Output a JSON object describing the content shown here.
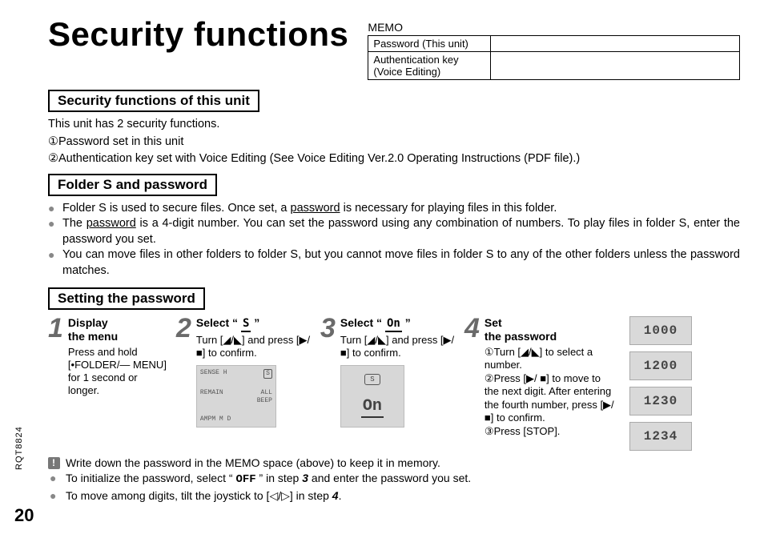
{
  "title": "Security functions",
  "memo": {
    "label": "MEMO",
    "row1": "Password (This unit)",
    "row2": "Authentication key\n(Voice Editing)"
  },
  "sections": {
    "sec1_head": "Security functions of this unit",
    "sec1_intro": "This unit has 2 security functions.",
    "sec1_item1": "①Password set in this unit",
    "sec1_item2": "②Authentication key set with Voice Editing (See Voice Editing Ver.2.0 Operating Instructions (PDF file).)",
    "sec2_head": "Folder S and password",
    "sec2_b1a": "Folder S is used to secure files. Once set, a ",
    "sec2_b1b": "password",
    "sec2_b1c": " is necessary for playing files in this folder.",
    "sec2_b2a": "The ",
    "sec2_b2b": "password",
    "sec2_b2c": " is a 4-digit number. You can set the password using any combination of numbers. To play files in folder S, enter the password you set.",
    "sec2_b3": "You can move files in other folders to folder S, but you cannot move files in folder S to any of the other folders unless the password matches.",
    "sec3_head": "Setting the password"
  },
  "steps": {
    "s1_title": "Display\nthe menu",
    "s1_body": "Press and hold [•FOLDER/— MENU] for 1 second or longer.",
    "s2_title_pre": "Select “ ",
    "s2_title_icon": "S",
    "s2_title_post": " ”",
    "s2_body": "Turn [◢/◣] and press [▶/■] to confirm.",
    "s3_title_pre": "Select “ ",
    "s3_title_icon": "On",
    "s3_title_post": " ”",
    "s3_body": "Turn [◢/◣] and press [▶/■] to confirm.",
    "s4_title": "Set\nthe password",
    "s4_i1": "①Turn [◢/◣] to select a number.",
    "s4_i2": "②Press [▶/ ■] to move to the next digit. After entering the fourth number, press [▶/ ■] to confirm.",
    "s4_i3": "③Press [STOP]."
  },
  "lcd": {
    "v1": "1000",
    "v2": "1200",
    "v3": "1230",
    "v4": "1234",
    "panel_top": "SENSE H",
    "panel_rows": [
      "REMAIN",
      "AMPM   M   D"
    ],
    "panel_side": [
      "ALL",
      "BEEP"
    ],
    "panel_s": "S",
    "panel2_on": "On"
  },
  "notes": {
    "n1": "Write down the password in the MEMO space (above) to keep it in memory.",
    "n2a": "To initialize the password, select “ ",
    "n2b": "OFF",
    "n2c": " ” in step ",
    "n2d": "3",
    "n2e": " and enter the password you set.",
    "n3a": "To move among digits, tilt the joystick to [◁/▷] in step ",
    "n3b": "4",
    "n3c": "."
  },
  "page_number": "20",
  "doc_code": "RQT8824"
}
